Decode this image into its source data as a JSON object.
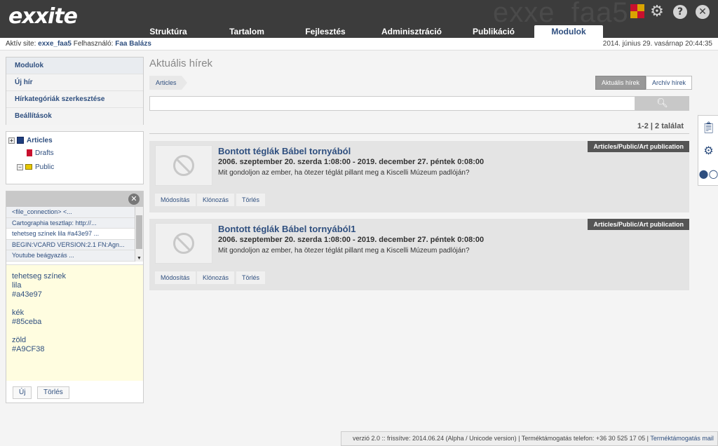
{
  "header": {
    "logo": "exxite",
    "site_watermark": "exxe_faa5",
    "icons": [
      "gear-icon",
      "help-icon",
      "close-icon"
    ],
    "tabs": [
      {
        "label": "Struktúra"
      },
      {
        "label": "Tartalom"
      },
      {
        "label": "Fejlesztés"
      },
      {
        "label": "Adminisztráció"
      },
      {
        "label": "Publikáció"
      },
      {
        "label": "Modulok",
        "active": true
      }
    ],
    "accent_color": "#2f4f7f"
  },
  "subheader": {
    "site_label": "Aktív site:",
    "site_value": "exxe_faa5",
    "user_label": "Felhasználó:",
    "user_value": "Faa Balázs",
    "datetime": "2014. június 29. vasárnap 20:44:35"
  },
  "leftmenu": {
    "items": [
      "Modulok",
      "Új hír",
      "Hírkategóriák szerkesztése",
      "Beállítások"
    ]
  },
  "tree": {
    "root": "Articles",
    "children": [
      "Drafts",
      "Public"
    ]
  },
  "clipboard": {
    "items": [
      "<file_connection> <...",
      "Cartographia tesztlap: http://...",
      "tehetseg színek lila #a43e97 ...",
      "BEGIN:VCARD VERSION:2.1 FN:Agn...",
      "Youtube beágyazás ..."
    ],
    "selected_index": 2,
    "content": "tehetseg színek\nlila\n#a43e97\n\nkék\n#85ceba\n\nzöld\n#A9CF38",
    "new_label": "Új",
    "delete_label": "Törlés"
  },
  "main": {
    "title": "Aktuális hírek",
    "breadcrumb": "Articles",
    "tab_current": "Aktuális hírek",
    "tab_archive": "Archív hírek",
    "search_value": "",
    "results": "1-2 | 2 találat",
    "items": [
      {
        "tag": "Articles/Public/Art publication",
        "title": "Bontott téglák Bábel tornyából",
        "date": "2006. szeptember 20. szerda 1:08:00 - 2019. december 27. péntek 0:08:00",
        "desc": "Mit gondoljon az ember, ha ötezer téglát pillant meg a Kiscelli Múzeum padlóján?",
        "btn_edit": "Módosítás",
        "btn_clone": "Klónozás",
        "btn_delete": "Törlés"
      },
      {
        "tag": "Articles/Public/Art publication",
        "title": "Bontott téglák Bábel tornyából1",
        "date": "2006. szeptember 20. szerda 1:08:00 - 2019. december 27. péntek 0:08:00",
        "desc": "Mit gondoljon az ember, ha ötezer téglát pillant meg a Kiscelli Múzeum padlóján?",
        "btn_edit": "Módosítás",
        "btn_clone": "Klónozás",
        "btn_delete": "Törlés"
      }
    ]
  },
  "sidetools": [
    "clipboard-icon",
    "settings-icon",
    "toggle-icon"
  ],
  "footer": {
    "text": "verzió 2.0 :: frissítve: 2014.06.24 (Alpha / Unicode version) | Terméktámogatás telefon: +36 30 525 17 05 | ",
    "link": "Terméktámogatás mail"
  }
}
